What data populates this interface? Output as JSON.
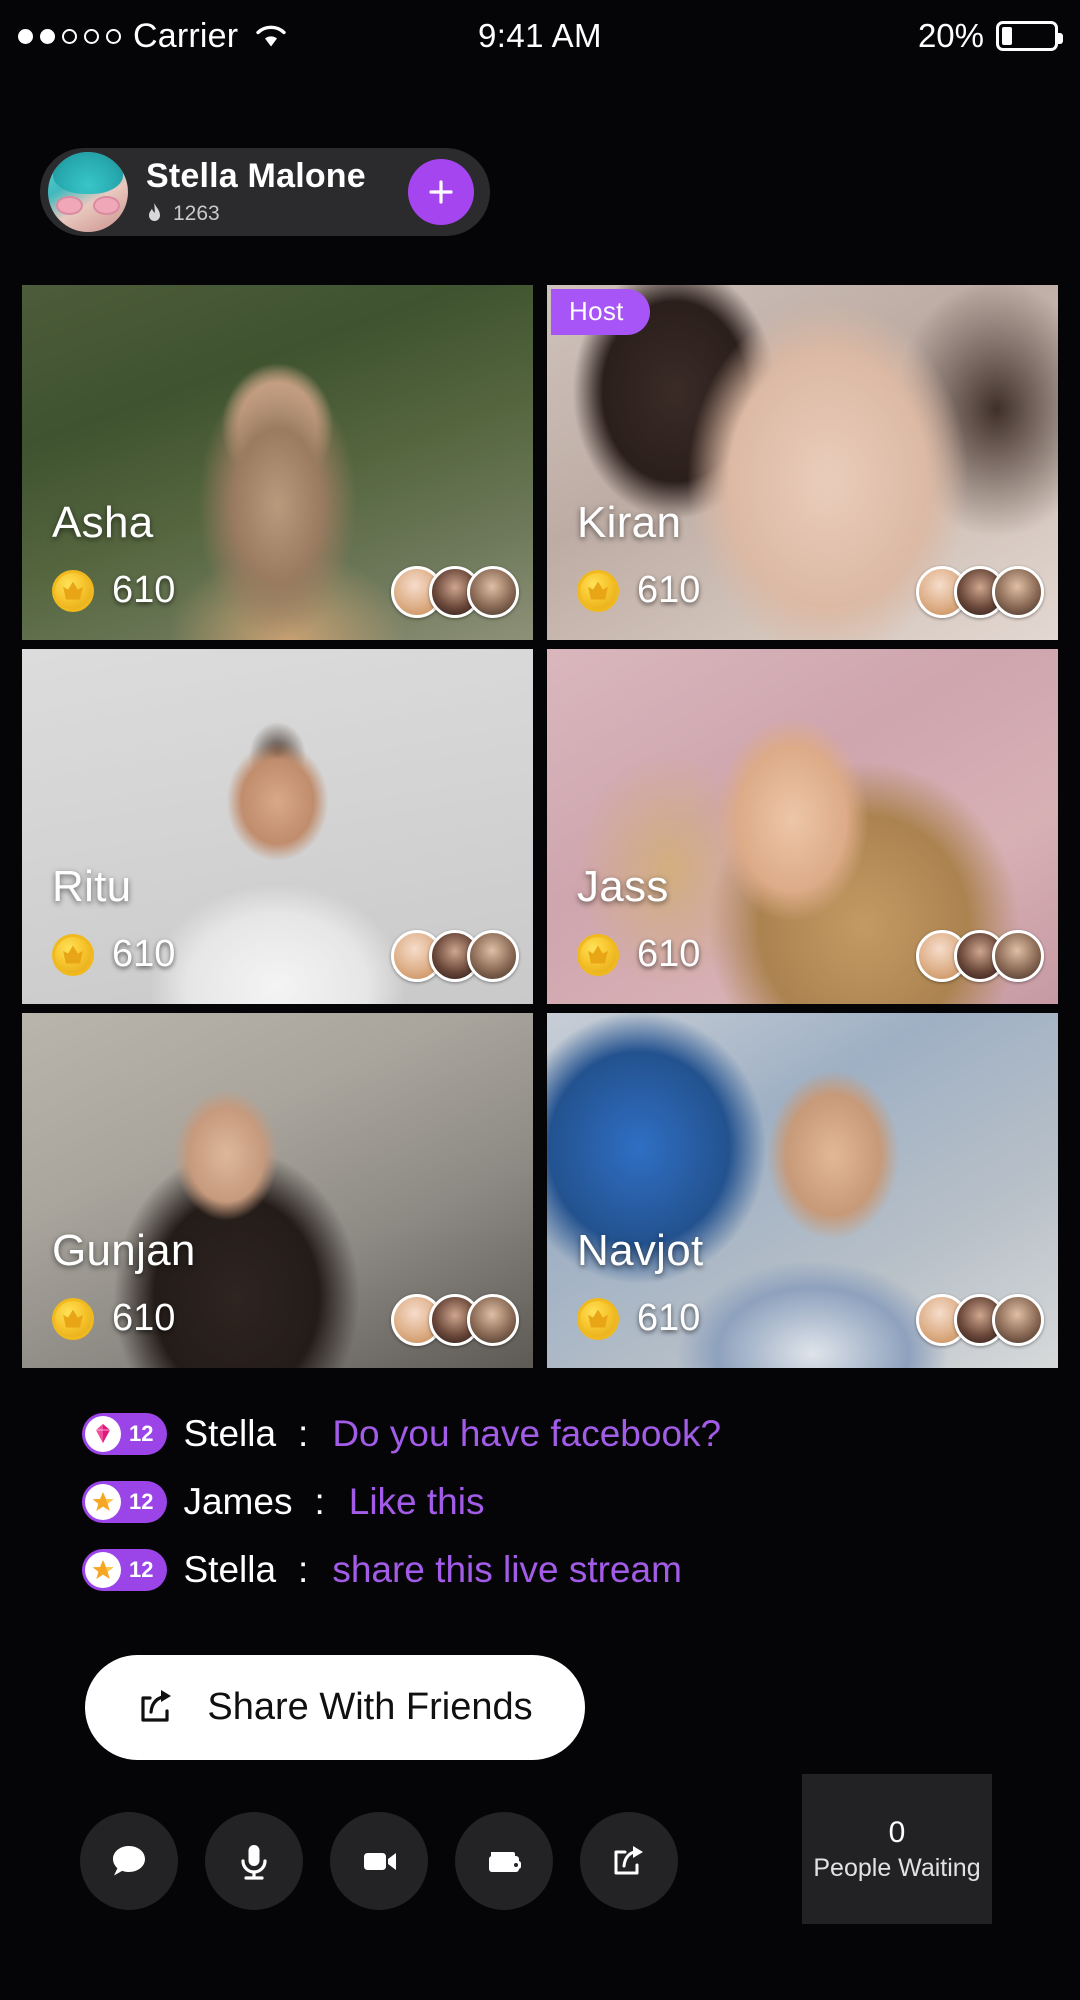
{
  "status_bar": {
    "carrier": "Carrier",
    "signal_dots_total": 5,
    "signal_dots_filled": 2,
    "time": "9:41 AM",
    "battery_percent": "20%",
    "battery_level": 20,
    "wifi_icon": "wifi-icon"
  },
  "header": {
    "user_name": "Stella Malone",
    "coins": "1263",
    "coin_icon": "flame-icon",
    "add_button_icon": "plus-icon",
    "avatar_icon": "user-avatar"
  },
  "grid": {
    "coin_icon": "coin-icon",
    "tiles": [
      {
        "name": "Asha",
        "coins": "610",
        "host": false,
        "badge": "",
        "viewers": 3
      },
      {
        "name": "Kiran",
        "coins": "610",
        "host": true,
        "badge": "Host",
        "viewers": 3
      },
      {
        "name": "Ritu",
        "coins": "610",
        "host": false,
        "badge": "",
        "viewers": 3
      },
      {
        "name": "Jass",
        "coins": "610",
        "host": false,
        "badge": "",
        "viewers": 3
      },
      {
        "name": "Gunjan",
        "coins": "610",
        "host": false,
        "badge": "",
        "viewers": 3
      },
      {
        "name": "Navjot",
        "coins": "610",
        "host": false,
        "badge": "",
        "viewers": 3
      }
    ]
  },
  "chat": {
    "separator": ":",
    "messages": [
      {
        "level": "12",
        "level_icon": "diamond-icon",
        "name": "Stella",
        "text": "Do you have facebook?"
      },
      {
        "level": "12",
        "level_icon": "star-icon",
        "name": "James",
        "text": "Like this"
      },
      {
        "level": "12",
        "level_icon": "star-icon",
        "name": "Stella",
        "text": "share this live stream"
      }
    ]
  },
  "share_button": {
    "label": "Share With Friends",
    "icon": "share-icon"
  },
  "toolbar": {
    "buttons": [
      {
        "icon": "chat-bubble-icon",
        "name": "chat"
      },
      {
        "icon": "microphone-icon",
        "name": "microphone"
      },
      {
        "icon": "video-camera-icon",
        "name": "video"
      },
      {
        "icon": "wallet-icon",
        "name": "wallet"
      },
      {
        "icon": "share-icon",
        "name": "share"
      }
    ]
  },
  "waiting_panel": {
    "count": "0",
    "label": "People Waiting"
  },
  "colors": {
    "background": "#050508",
    "accent_purple": "#a855f7",
    "host_border": "#9b3fe8",
    "chat_message": "#a25ce8",
    "coin_gold": "#f7c52e",
    "pill_bg": "#2b2b2e"
  }
}
